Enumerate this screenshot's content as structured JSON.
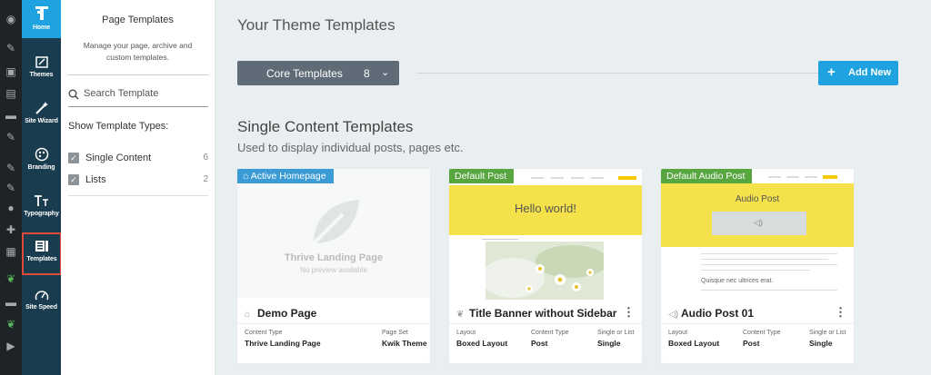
{
  "sidebar": {
    "items": [
      {
        "label": "Home",
        "icon": "home-icon"
      },
      {
        "label": "Themes",
        "icon": "themes-icon"
      },
      {
        "label": "Site Wizard",
        "icon": "wand-icon"
      },
      {
        "label": "Branding",
        "icon": "palette-icon"
      },
      {
        "label": "Typography",
        "icon": "typography-icon"
      },
      {
        "label": "Templates",
        "icon": "templates-icon"
      },
      {
        "label": "Site Speed",
        "icon": "speedometer-icon"
      }
    ]
  },
  "panel": {
    "title": "Page Templates",
    "description": "Manage your page, archive and custom templates.",
    "search_placeholder": "Search Template",
    "types_title": "Show Template Types:",
    "types": [
      {
        "name": "Single Content",
        "count": "6"
      },
      {
        "name": "Lists",
        "count": "2"
      }
    ]
  },
  "main": {
    "title": "Your Theme Templates",
    "dropdown": {
      "label": "Core Templates",
      "count": "8"
    },
    "add_new": "Add New",
    "section_title": "Single Content Templates",
    "section_desc": "Used to display individual posts, pages etc.",
    "cards": [
      {
        "badge": "Active Homepage",
        "name": "Demo Page",
        "preview_title": "Thrive Landing Page",
        "preview_sub": "No preview available",
        "meta": [
          {
            "label": "Content Type",
            "value": "Thrive Landing Page"
          },
          {
            "label": "Page Set",
            "value": "Kwik Theme"
          }
        ]
      },
      {
        "badge": "Default Post",
        "name": "Title Banner without Sidebar",
        "preview_title": "Hello world!",
        "meta": [
          {
            "label": "Layout",
            "value": "Boxed Layout"
          },
          {
            "label": "Content Type",
            "value": "Post"
          },
          {
            "label": "Single or List",
            "value": "Single"
          }
        ]
      },
      {
        "badge": "Default Audio Post",
        "name": "Audio Post 01",
        "preview_title": "Audio Post",
        "preview_quote": "Quisque nec ultrices erat.",
        "meta": [
          {
            "label": "Layout",
            "value": "Boxed Layout"
          },
          {
            "label": "Content Type",
            "value": "Post"
          },
          {
            "label": "Single or List",
            "value": "Single"
          }
        ]
      }
    ]
  },
  "colors": {
    "accent": "#1fa3e0",
    "sidebar": "#1a3c4f",
    "badge_blue": "#3a9bd5",
    "badge_green": "#57a640",
    "selected_outline": "#e04a3b"
  }
}
